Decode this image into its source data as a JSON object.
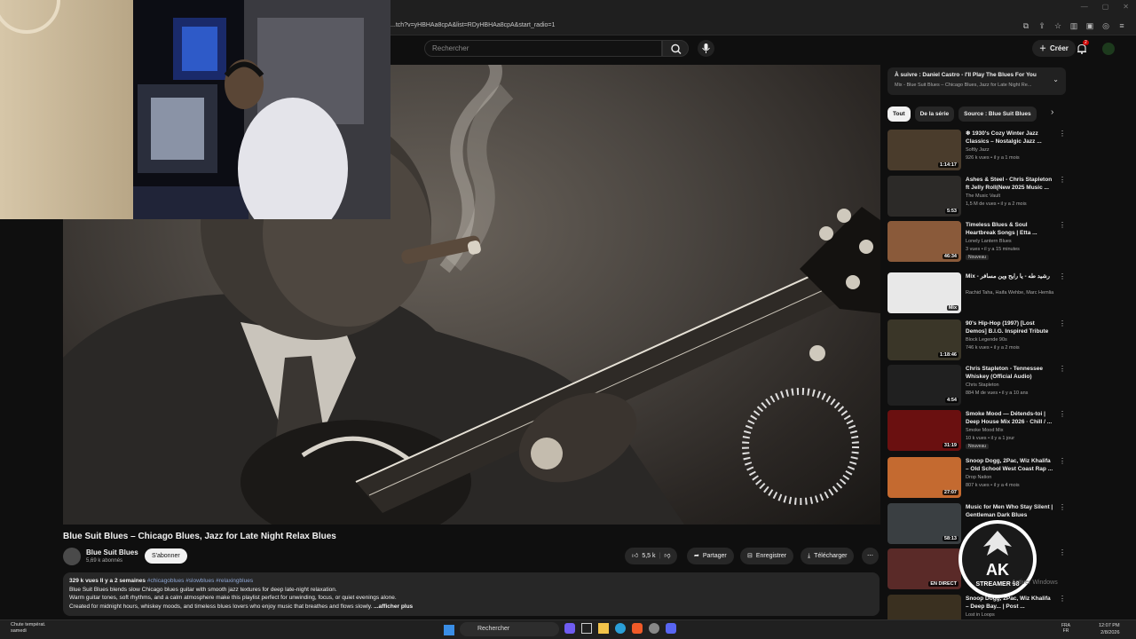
{
  "browser": {
    "url": "...tch?v=yHBHAa8cpA&list=RDyHBHAa8cpA&start_radio=1"
  },
  "header": {
    "search_placeholder": "Rechercher",
    "create_label": "Créer",
    "notification_count": "2"
  },
  "video": {
    "title": "Blue Suit Blues – Chicago Blues, Jazz for Late Night Relax Blues",
    "channel_name": "Blue Suit Blues",
    "subscribers": "5,69 k abonnés",
    "subscribe_label": "S'abonner",
    "likes": "5,5 k",
    "share_label": "Partager",
    "save_label": "Enregistrer",
    "download_label": "Télécharger"
  },
  "description": {
    "meta": "329 k vues  Il y a 2 semaines",
    "tags": "#chicagoblues #slowblues #relaxingblues",
    "line1": "Blue Suit Blues blends slow Chicago blues guitar with smooth jazz textures for deep late-night relaxation.",
    "line2": "Warm guitar tones, soft rhythms, and a calm atmosphere make this playlist perfect for unwinding, focus, or quiet evenings alone.",
    "line3": "Created for midnight hours, whiskey moods, and timeless blues lovers who enjoy music that breathes and flows slowly.",
    "more": "...afficher plus"
  },
  "sidebar": {
    "up_next_title": "À suivre : Daniel Castro - I'll Play The Blues For You",
    "up_next_sub": "Mix - Blue Suit Blues – Chicago Blues, Jazz for Late Night Re...",
    "chips": [
      "Tout",
      "De la série",
      "Source : Blue Suit Blues"
    ],
    "items": [
      {
        "title": "❄ 1930's Cozy Winter Jazz Classics – Nostalgic Jazz ...",
        "channel": "Softly Jazz",
        "views": "926 k vues • il y a 1 mois",
        "duration": "1:14:17",
        "badge": ""
      },
      {
        "title": "Ashes & Steel - Chris Stapleton ft Jelly Roll(New 2025 Music ...",
        "channel": "The Music Vault",
        "views": "1,5 M de vues • il y a 2 mois",
        "duration": "5:53",
        "badge": ""
      },
      {
        "title": "Timeless Blues & Soul Heartbreak Songs | Etta ...",
        "channel": "Lonely Lantern Blues",
        "views": "3 vues • il y a 15 minutes",
        "duration": "46:34",
        "badge": "Nouveau"
      },
      {
        "title": "Mix - رشيد طه - يا رايح وين مسافر",
        "channel": "Rachid Taha, Haifa Wehbe, Marc Hemlia ...",
        "views": "",
        "duration": "Mix",
        "badge": ""
      },
      {
        "title": "90's Hip-Hop (1997) [Lost Demos] B.I.G. Inspired Tribute ...",
        "channel": "Block Legende 90s",
        "views": "746 k vues • il y a 2 mois",
        "duration": "1:18:46",
        "badge": ""
      },
      {
        "title": "Chris Stapleton - Tennessee Whiskey (Official Audio)",
        "channel": "Chris Stapleton",
        "views": "884 M de vues • il y a 10 ans",
        "duration": "4:54",
        "badge": ""
      },
      {
        "title": "Smoke Mood — Détends-toi | Deep House Mix 2026 · Chill / ...",
        "channel": "Smoke Mood Mix",
        "views": "10 k vues • il y a 1 jour",
        "duration": "31:19",
        "badge": "Nouveau"
      },
      {
        "title": "Snoop Dogg, 2Pac, Wiz Khalifa – Old School West Coast Rap ...",
        "channel": "Drop Nation",
        "views": "807 k vues • il y a 4 mois",
        "duration": "27:07",
        "badge": ""
      },
      {
        "title": "Music for Men Who Stay Silent | Gentleman Dark Blues",
        "channel": "",
        "views": "",
        "duration": "58:13",
        "badge": ""
      },
      {
        "title": "Radio ...",
        "channel": "",
        "views": "",
        "duration": "EN DIRECT",
        "badge": ""
      },
      {
        "title": "Snoop Dogg, 2Pac, Wiz Khalifa – Deep Bay... | Post ...",
        "channel": "Lost in Loops",
        "views": "",
        "duration": "",
        "badge": ""
      }
    ]
  },
  "overlay": {
    "watermark_text": "STREAMER 98",
    "watermark_letters": "AK",
    "activate_text": "Activer Windows"
  },
  "taskbar": {
    "weather_line1": "Chute températ.",
    "weather_line2": "samedi",
    "search_label": "Rechercher",
    "lang_line1": "FRA",
    "lang_line2": "FR",
    "time": "12:07 PM",
    "date": "2/8/2026"
  },
  "colors": {
    "background": "#0f0f0f",
    "accent_red": "#cc0000",
    "surface": "#272727"
  }
}
